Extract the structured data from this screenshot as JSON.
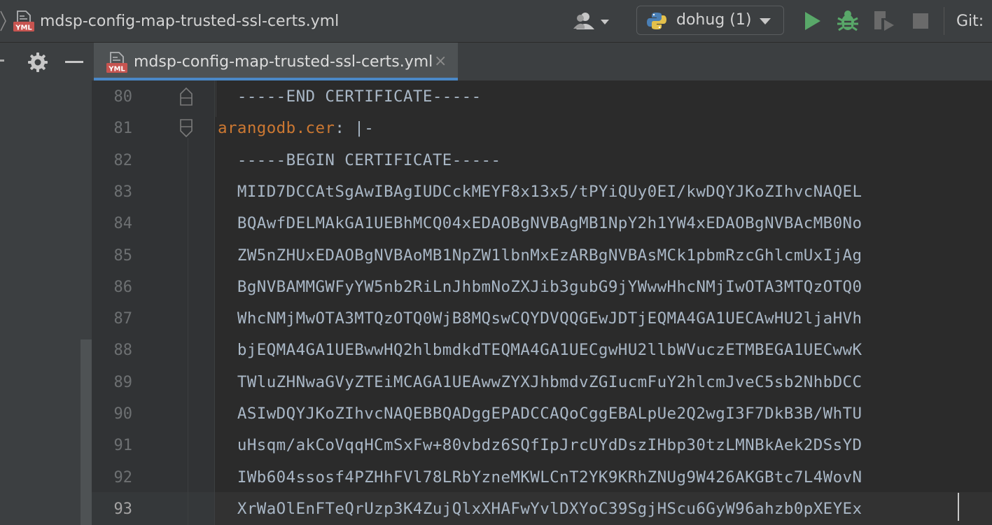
{
  "window": {
    "file_title": "mdsp-config-map-trusted-ssl-certs.yml",
    "file_icon": "yml-file-icon"
  },
  "toolbar": {
    "user_icon": "user-icon",
    "run_config_label": "dohug (1)",
    "run_config_icon": "python-icon",
    "run_icon": "run-icon",
    "debug_icon": "debug-bug-icon",
    "profile_icon": "run-with-coverage-icon",
    "stop_icon": "stop-icon",
    "git_label": "Git:",
    "colors": {
      "run": "#59a869",
      "debug": "#59a869",
      "disabled": "#6a6a6a"
    }
  },
  "tool_window": {
    "gear_icon": "gear-icon",
    "hide_icon": "minus-icon"
  },
  "tabs": [
    {
      "label": "mdsp-config-map-trusted-ssl-certs.yml",
      "close": "×",
      "active": true,
      "icon": "yml-file-icon"
    }
  ],
  "editor": {
    "key_color": "#cc7832",
    "text_color": "#a9b7c6",
    "lines": [
      {
        "n": "80",
        "text": "  -----END CERTIFICATE-----"
      },
      {
        "n": "81",
        "key": "arangodb.cer",
        "rest": ": |-"
      },
      {
        "n": "82",
        "text": "  -----BEGIN CERTIFICATE-----"
      },
      {
        "n": "83",
        "text": "  MIID7DCCAtSgAwIBAgIUDCckMEYF8x13x5/tPYiQUy0EI/kwDQYJKoZIhvcNAQEL"
      },
      {
        "n": "84",
        "text": "  BQAwfDELMAkGA1UEBhMCQ04xEDAOBgNVBAgMB1NpY2h1YW4xEDAOBgNVBAcMB0No"
      },
      {
        "n": "85",
        "text": "  ZW5nZHUxEDAOBgNVBAoMB1NpZW1lbnMxEzARBgNVBAsMCk1pbmRzcGhlcmUxIjAg"
      },
      {
        "n": "86",
        "text": "  BgNVBAMMGWFyYW5nb2RiLnJhbmNoZXJib3gubG9jYWwwHhcNMjIwOTA3MTQzOTQ0"
      },
      {
        "n": "87",
        "text": "  WhcNMjMwOTA3MTQzOTQ0WjB8MQswCQYDVQQGEwJDTjEQMA4GA1UECAwHU2ljaHVh"
      },
      {
        "n": "88",
        "text": "  bjEQMA4GA1UEBwwHQ2hlbmdkdTEQMA4GA1UECgwHU2llbWVuczETMBEGA1UECwwK"
      },
      {
        "n": "89",
        "text": "  TWluZHNwaGVyZTEiMCAGA1UEAwwZYXJhbmdvZGIucmFuY2hlcmJveC5sb2NhbDCC"
      },
      {
        "n": "90",
        "text": "  ASIwDQYJKoZIhvcNAQEBBQADggEPADCCAQoCggEBALpUe2Q2wgI3F7DkB3B/WhTU"
      },
      {
        "n": "91",
        "text": "  uHsqm/akCoVqqHCmSxFw+80vbdz6SQfIpJrcUYdDszIHbp30tzLMNBkAek2DSsYD"
      },
      {
        "n": "92",
        "text": "  IWb604ssosf4PZHhFVl78LRbYzneMKWLCnT2YK9KRhZNUg9W426AKGBtc7L4WovN"
      },
      {
        "n": "93",
        "text": "  XrWaOlEnFTeQrUzp3K4ZujQlxXHAFwYvlDXYoC39SgjHScu6GyW96ahzb0pXEYEx",
        "active": true
      }
    ]
  }
}
